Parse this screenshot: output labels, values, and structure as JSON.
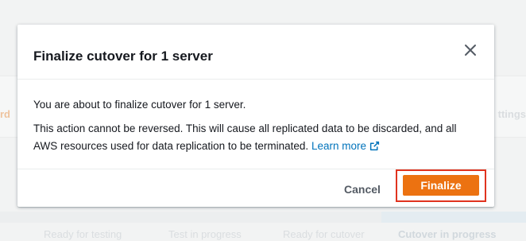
{
  "background": {
    "left_fragment": "rd",
    "right_fragment": "ttings",
    "steps": [
      "Ready for testing",
      "Test in progress",
      "Ready for cutover",
      "Cutover in progress"
    ]
  },
  "modal": {
    "title": "Finalize cutover for 1 server",
    "close_icon": "close-icon",
    "body": {
      "line1": "You are about to finalize cutover for 1 server.",
      "line2": "This action cannot be reversed. This will cause all replicated data to be discarded, and all AWS resources used for data replication to be terminated.",
      "learn_more": "Learn more",
      "learn_more_icon": "external-link-icon"
    },
    "footer": {
      "cancel_label": "Cancel",
      "finalize_label": "Finalize"
    }
  },
  "colors": {
    "primary_button": "#ec7211",
    "link": "#0073bb",
    "highlight_box": "#e0331f"
  }
}
